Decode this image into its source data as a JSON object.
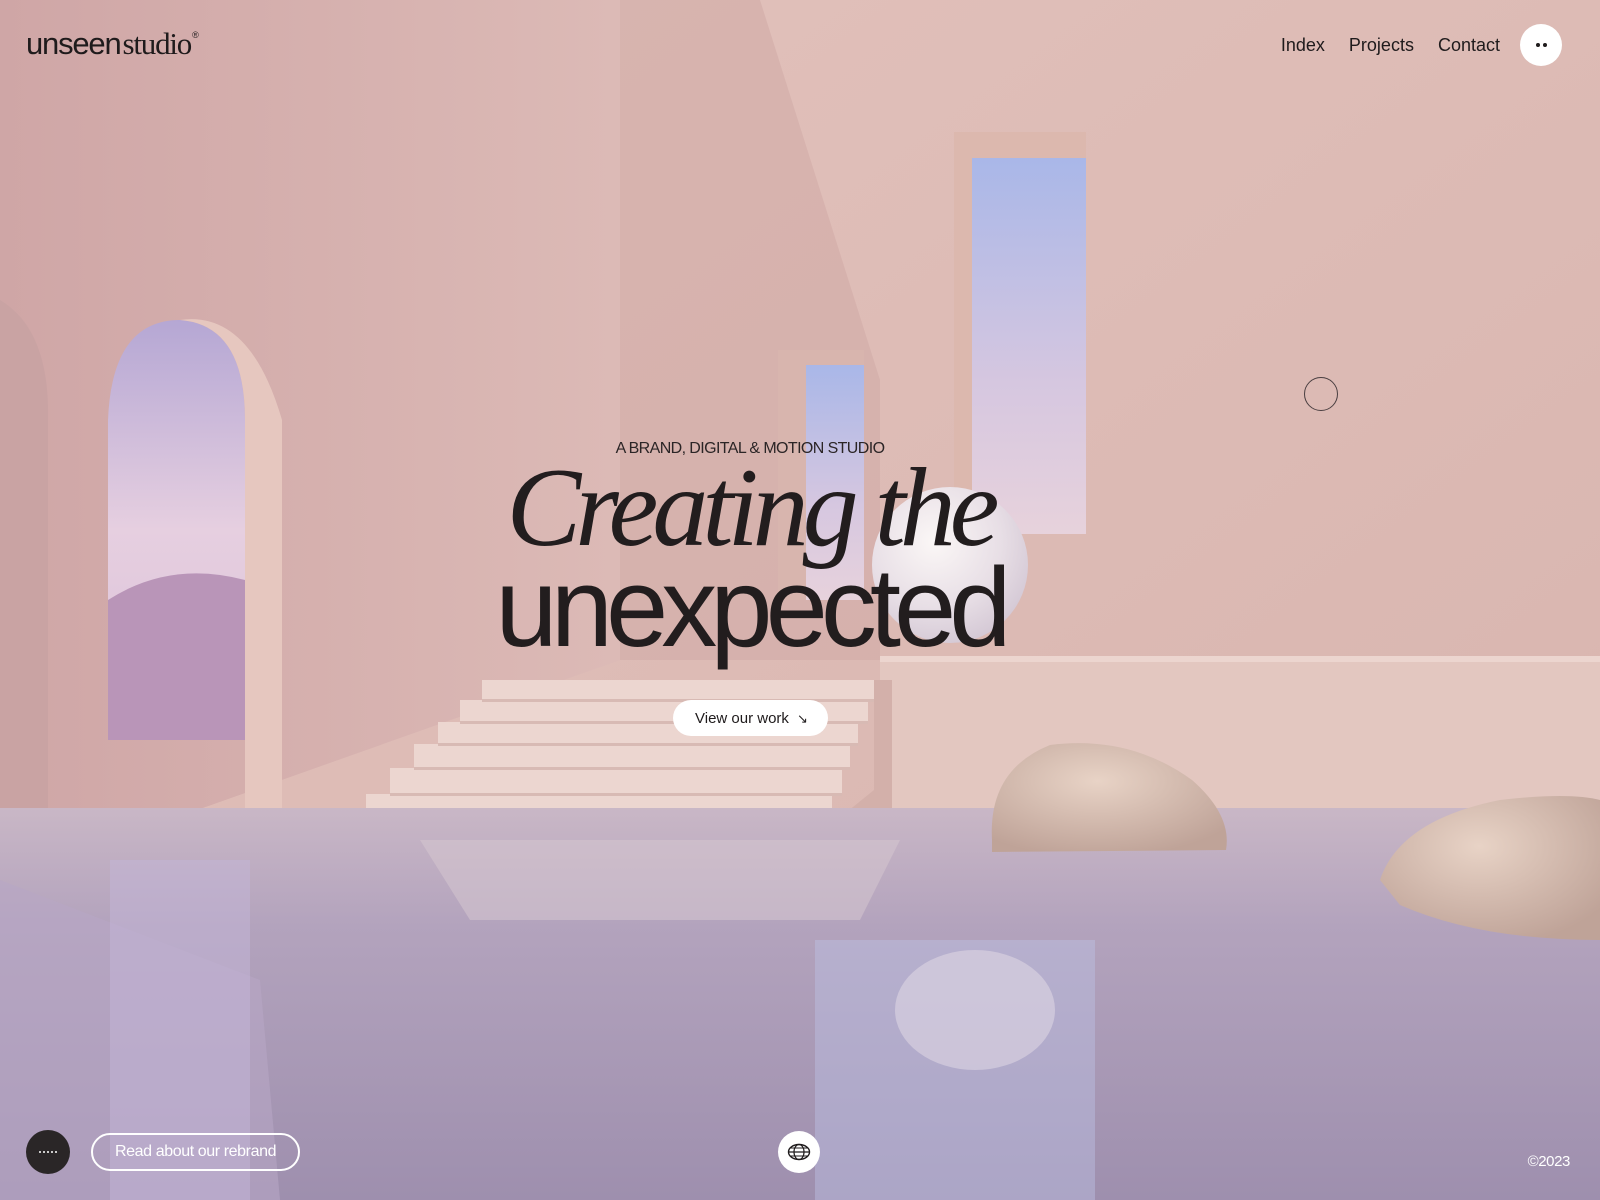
{
  "header": {
    "logo_primary": "unseen",
    "logo_secondary": "studio",
    "logo_mark": "®",
    "nav": [
      "Index",
      "Projects",
      "Contact"
    ],
    "menu_icon": "two-dots-menu-icon"
  },
  "hero": {
    "eyebrow": "A BRAND, DIGITAL & MOTION STUDIO",
    "headline_line1": "Creating the",
    "headline_line2": "unexpected",
    "cta_label": "View our work",
    "cta_icon": "arrow-down-right-icon"
  },
  "footer": {
    "rebrand_label": "Read about our rebrand",
    "dots_icon": "dots-icon",
    "globe_icon": "globe-icon",
    "copyright": "©2023"
  },
  "colors": {
    "text_dark": "#1f1b1c",
    "wall_pink": "#d9b7b3",
    "water_lilac": "#a597b5",
    "white": "#ffffff"
  }
}
